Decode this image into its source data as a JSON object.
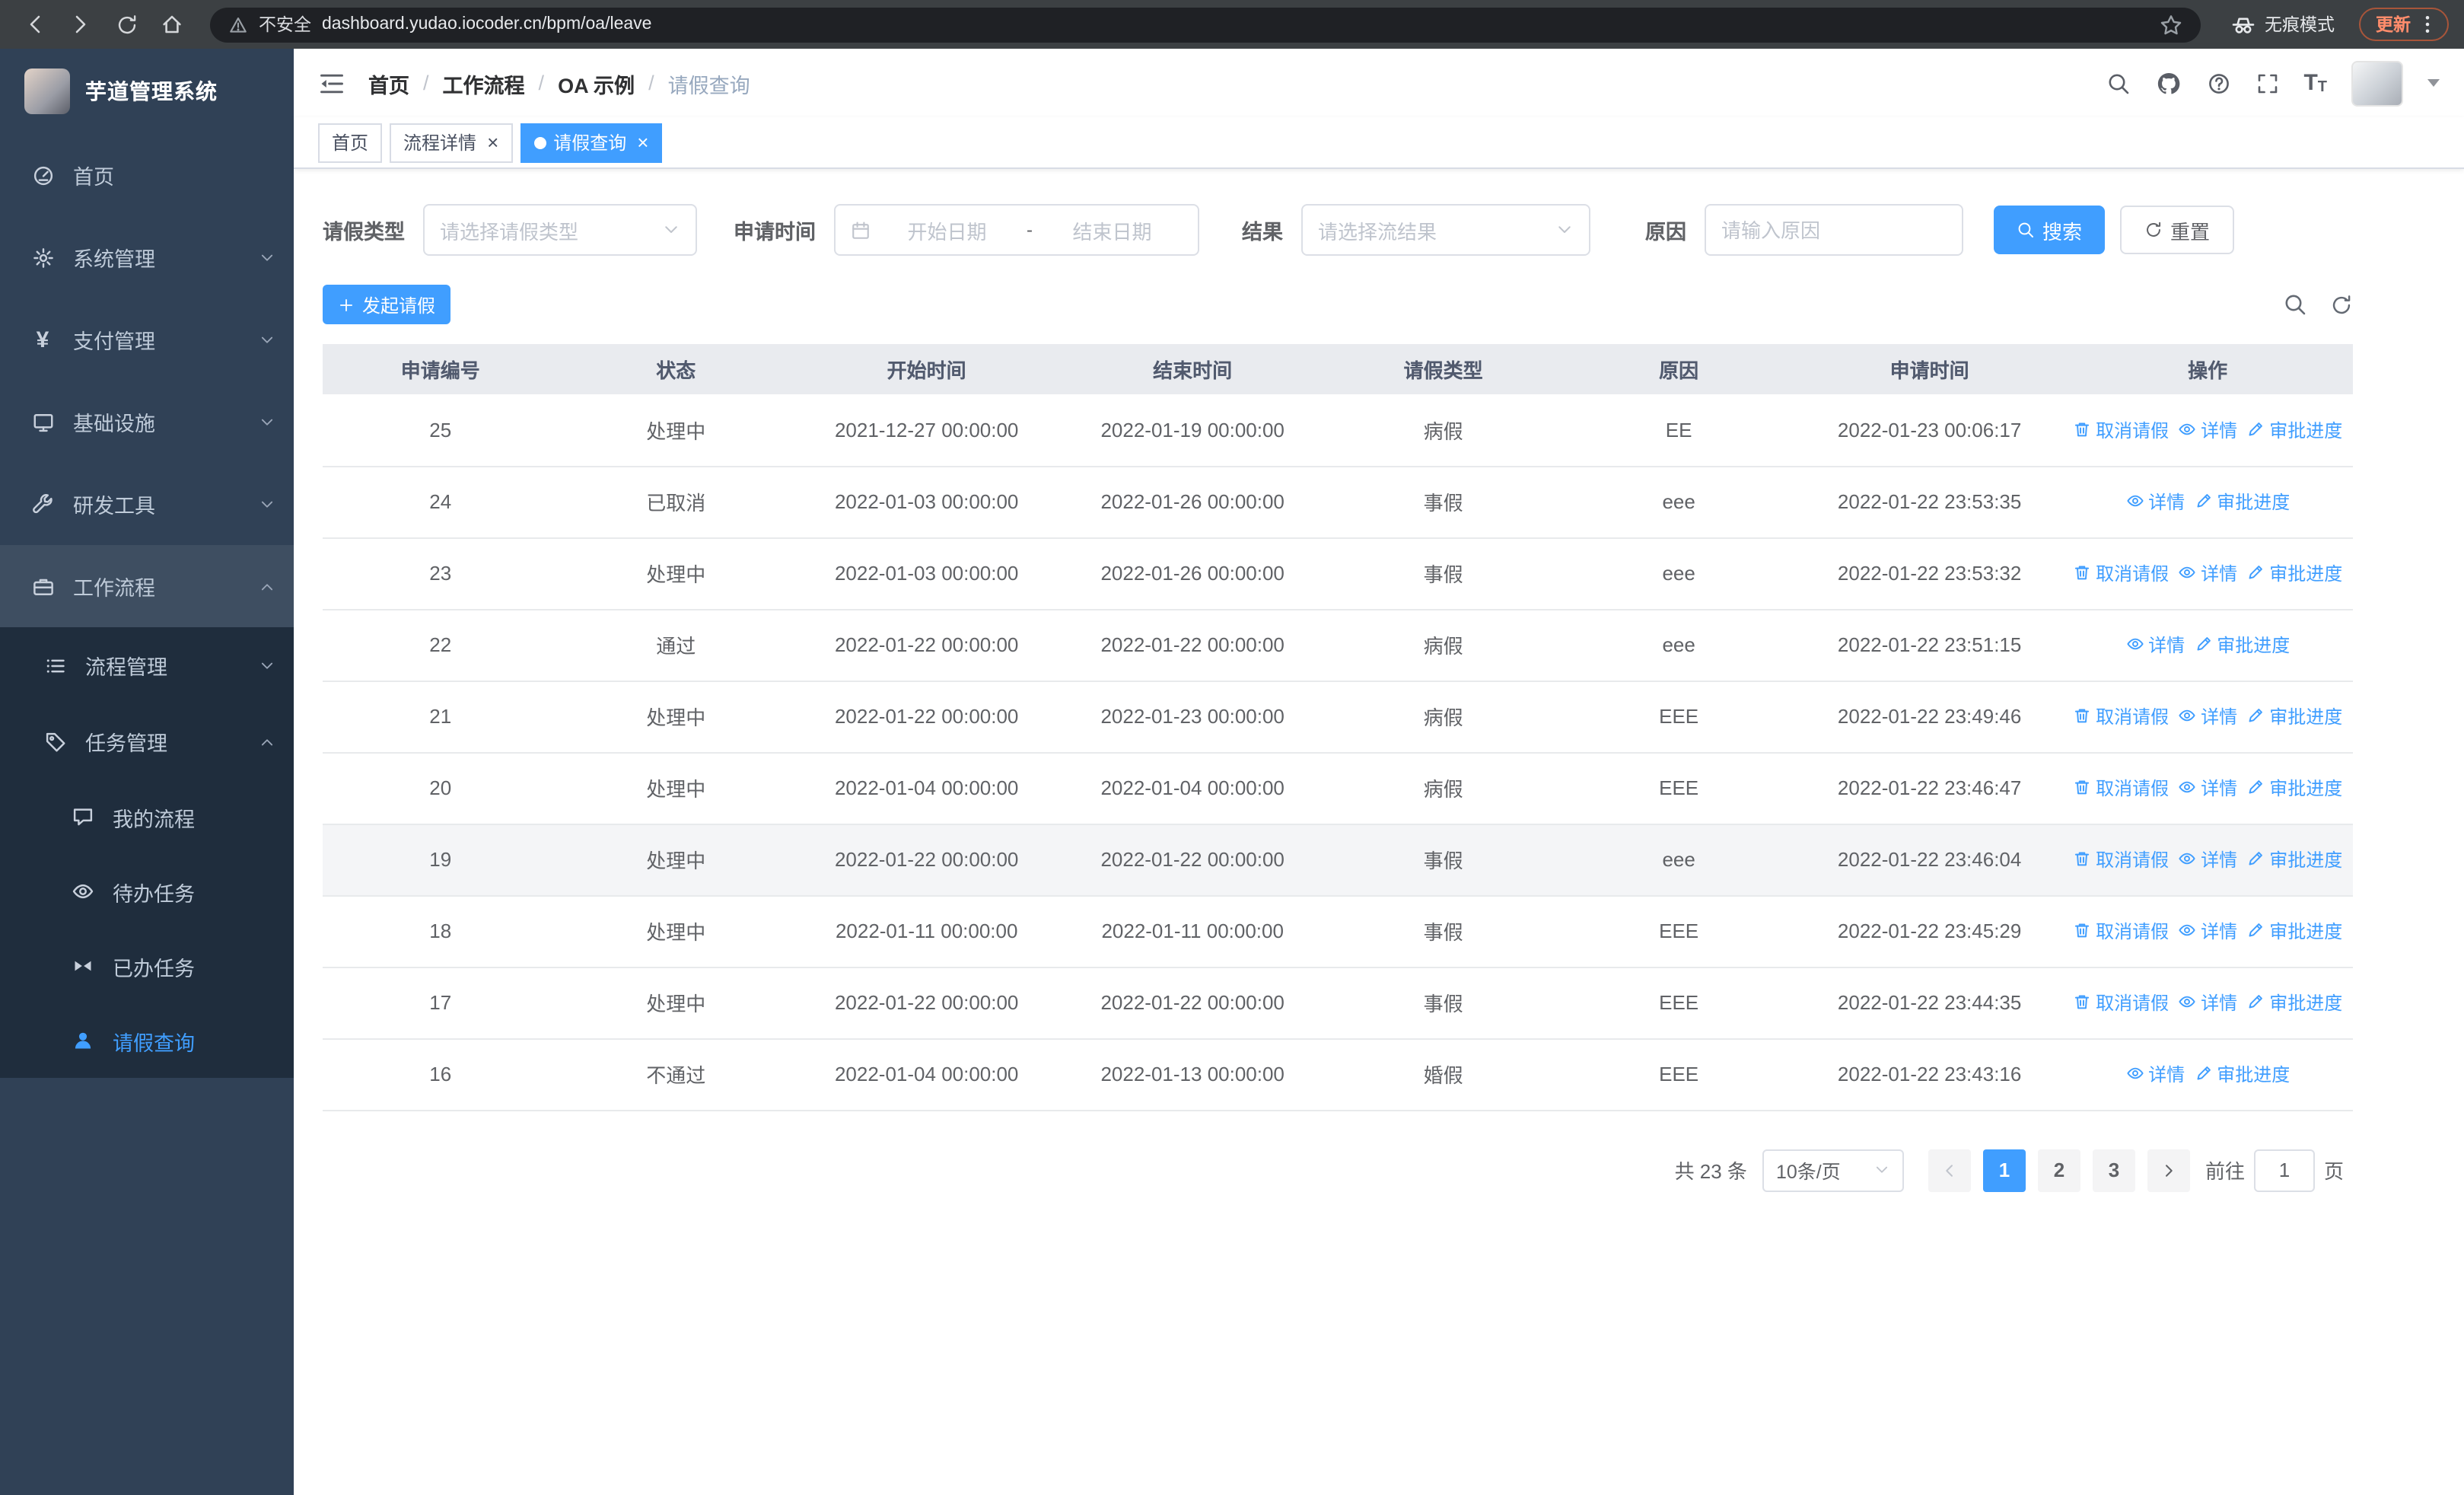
{
  "browser": {
    "security_label": "不安全",
    "url": "dashboard.yudao.iocoder.cn/bpm/oa/leave",
    "incognito_label": "无痕模式",
    "update_label": "更新"
  },
  "sidebar": {
    "logo_title": "芋道管理系统",
    "menu": [
      {
        "name": "home",
        "label": "首页",
        "icon": "gauge",
        "level": 0
      },
      {
        "name": "system-management",
        "label": "系统管理",
        "icon": "gear",
        "level": 0,
        "arrow": "down"
      },
      {
        "name": "payment-management",
        "label": "支付管理",
        "icon": "yen",
        "level": 0,
        "arrow": "down"
      },
      {
        "name": "infrastructure",
        "label": "基础设施",
        "icon": "monitor",
        "level": 0,
        "arrow": "down"
      },
      {
        "name": "dev-tools",
        "label": "研发工具",
        "icon": "wrench",
        "level": 0,
        "arrow": "down"
      },
      {
        "name": "workflow",
        "label": "工作流程",
        "icon": "briefcase",
        "level": 0,
        "arrow": "up",
        "highlight": true
      },
      {
        "name": "process-management",
        "label": "流程管理",
        "icon": "list",
        "level": 1,
        "arrow": "down"
      },
      {
        "name": "task-management",
        "label": "任务管理",
        "icon": "tag",
        "level": 1,
        "arrow": "up"
      },
      {
        "name": "my-process",
        "label": "我的流程",
        "icon": "chat",
        "level": 2
      },
      {
        "name": "todo-tasks",
        "label": "待办任务",
        "icon": "eye",
        "level": 2
      },
      {
        "name": "done-tasks",
        "label": "已办任务",
        "icon": "bowtie",
        "level": 2
      },
      {
        "name": "leave-query",
        "label": "请假查询",
        "icon": "person",
        "level": 2,
        "active": true
      }
    ]
  },
  "header": {
    "breadcrumb": [
      {
        "name": "home",
        "label": "首页"
      },
      {
        "name": "workflow",
        "label": "工作流程"
      },
      {
        "name": "oa-example",
        "label": "OA 示例"
      },
      {
        "name": "leave-query",
        "label": "请假查询"
      }
    ]
  },
  "tabs": [
    {
      "name": "home",
      "label": "首页",
      "closable": false,
      "active": false
    },
    {
      "name": "process-detail",
      "label": "流程详情",
      "closable": true,
      "active": false
    },
    {
      "name": "leave-query",
      "label": "请假查询",
      "closable": true,
      "active": true
    }
  ],
  "filters": {
    "leave_type_label": "请假类型",
    "leave_type_placeholder": "请选择请假类型",
    "apply_time_label": "申请时间",
    "start_date_placeholder": "开始日期",
    "range_separator": "-",
    "end_date_placeholder": "结束日期",
    "result_label": "结果",
    "result_placeholder": "请选择流结果",
    "reason_label": "原因",
    "reason_placeholder": "请输入原因",
    "search_label": "搜索",
    "reset_label": "重置"
  },
  "toolbar": {
    "create_label": "发起请假"
  },
  "table": {
    "columns": [
      "申请编号",
      "状态",
      "开始时间",
      "结束时间",
      "请假类型",
      "原因",
      "申请时间",
      "操作"
    ],
    "action_labels": {
      "cancel": "取消请假",
      "detail": "详情",
      "progress": "审批进度"
    },
    "highlighted_id": "19",
    "rows": [
      {
        "id": "25",
        "status": "处理中",
        "start": "2021-12-27 00:00:00",
        "end": "2022-01-19 00:00:00",
        "type": "病假",
        "reason": "EE",
        "applied": "2022-01-23 00:06:17",
        "actions": [
          "cancel",
          "detail",
          "progress"
        ]
      },
      {
        "id": "24",
        "status": "已取消",
        "start": "2022-01-03 00:00:00",
        "end": "2022-01-26 00:00:00",
        "type": "事假",
        "reason": "eee",
        "applied": "2022-01-22 23:53:35",
        "actions": [
          "detail",
          "progress"
        ]
      },
      {
        "id": "23",
        "status": "处理中",
        "start": "2022-01-03 00:00:00",
        "end": "2022-01-26 00:00:00",
        "type": "事假",
        "reason": "eee",
        "applied": "2022-01-22 23:53:32",
        "actions": [
          "cancel",
          "detail",
          "progress"
        ]
      },
      {
        "id": "22",
        "status": "通过",
        "start": "2022-01-22 00:00:00",
        "end": "2022-01-22 00:00:00",
        "type": "病假",
        "reason": "eee",
        "applied": "2022-01-22 23:51:15",
        "actions": [
          "detail",
          "progress"
        ]
      },
      {
        "id": "21",
        "status": "处理中",
        "start": "2022-01-22 00:00:00",
        "end": "2022-01-23 00:00:00",
        "type": "病假",
        "reason": "EEE",
        "applied": "2022-01-22 23:49:46",
        "actions": [
          "cancel",
          "detail",
          "progress"
        ]
      },
      {
        "id": "20",
        "status": "处理中",
        "start": "2022-01-04 00:00:00",
        "end": "2022-01-04 00:00:00",
        "type": "病假",
        "reason": "EEE",
        "applied": "2022-01-22 23:46:47",
        "actions": [
          "cancel",
          "detail",
          "progress"
        ]
      },
      {
        "id": "19",
        "status": "处理中",
        "start": "2022-01-22 00:00:00",
        "end": "2022-01-22 00:00:00",
        "type": "事假",
        "reason": "eee",
        "applied": "2022-01-22 23:46:04",
        "actions": [
          "cancel",
          "detail",
          "progress"
        ]
      },
      {
        "id": "18",
        "status": "处理中",
        "start": "2022-01-11 00:00:00",
        "end": "2022-01-11 00:00:00",
        "type": "事假",
        "reason": "EEE",
        "applied": "2022-01-22 23:45:29",
        "actions": [
          "cancel",
          "detail",
          "progress"
        ]
      },
      {
        "id": "17",
        "status": "处理中",
        "start": "2022-01-22 00:00:00",
        "end": "2022-01-22 00:00:00",
        "type": "事假",
        "reason": "EEE",
        "applied": "2022-01-22 23:44:35",
        "actions": [
          "cancel",
          "detail",
          "progress"
        ]
      },
      {
        "id": "16",
        "status": "不通过",
        "start": "2022-01-04 00:00:00",
        "end": "2022-01-13 00:00:00",
        "type": "婚假",
        "reason": "EEE",
        "applied": "2022-01-22 23:43:16",
        "actions": [
          "detail",
          "progress"
        ]
      }
    ]
  },
  "pagination": {
    "total_label": "共 23 条",
    "page_size_label": "10条/页",
    "pages": [
      "1",
      "2",
      "3"
    ],
    "active_page": "1",
    "goto_label": "前往",
    "goto_value": "1",
    "goto_suffix_label": "页"
  },
  "colors": {
    "accent": "#409eff",
    "sidebar_bg": "#304156",
    "submenu_bg": "#1f2d3d"
  }
}
